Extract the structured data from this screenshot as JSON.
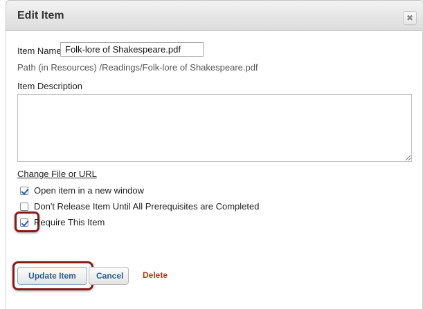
{
  "dialog": {
    "title": "Edit Item",
    "close_glyph": "✖",
    "close_icon": "close-icon"
  },
  "form": {
    "item_name_label": "Item Name",
    "item_name_value": "Folk-lore of Shakespeare.pdf",
    "path_text": "Path (in Resources) /Readings/Folk-lore of Shakespeare.pdf",
    "description_label": "Item Description",
    "description_value": "",
    "change_link": "Change File or URL",
    "options": [
      {
        "label": "Open item in a new window",
        "checked": true
      },
      {
        "label": "Don't Release Item Until All Prerequisites are Completed",
        "checked": false
      },
      {
        "label": "Require This Item",
        "checked": true
      }
    ]
  },
  "actions": {
    "update_label": "Update Item",
    "cancel_label": "Cancel",
    "delete_label": "Delete"
  },
  "colors": {
    "highlight": "#8a1a1a",
    "button_text": "#2a5d8f",
    "delete_text": "#b33a18",
    "check_mark": "#1a5fb4"
  }
}
